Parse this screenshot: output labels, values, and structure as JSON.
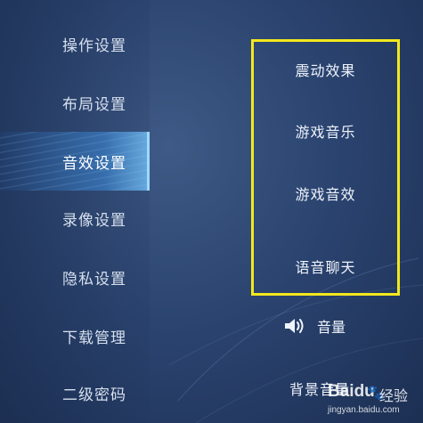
{
  "sidebar": {
    "items": [
      {
        "label": "操作设置",
        "active": false
      },
      {
        "label": "布局设置",
        "active": false
      },
      {
        "label": "音效设置",
        "active": true
      },
      {
        "label": "录像设置",
        "active": false
      },
      {
        "label": "隐私设置",
        "active": false
      },
      {
        "label": "下载管理",
        "active": false
      },
      {
        "label": "二级密码",
        "active": false
      }
    ]
  },
  "sound_options": {
    "vibration": "震动效果",
    "game_music": "游戏音乐",
    "game_sound": "游戏音效",
    "voice_chat": "语音聊天"
  },
  "volume": {
    "icon": "speaker-icon",
    "label": "音量",
    "background_volume_label": "背景音量"
  },
  "highlight_color": "#f3e81c",
  "active_accent": "#9fd9ff",
  "watermark": {
    "brand": "Baidu",
    "suffix": "经验",
    "url": "jingyan.baidu.com"
  }
}
